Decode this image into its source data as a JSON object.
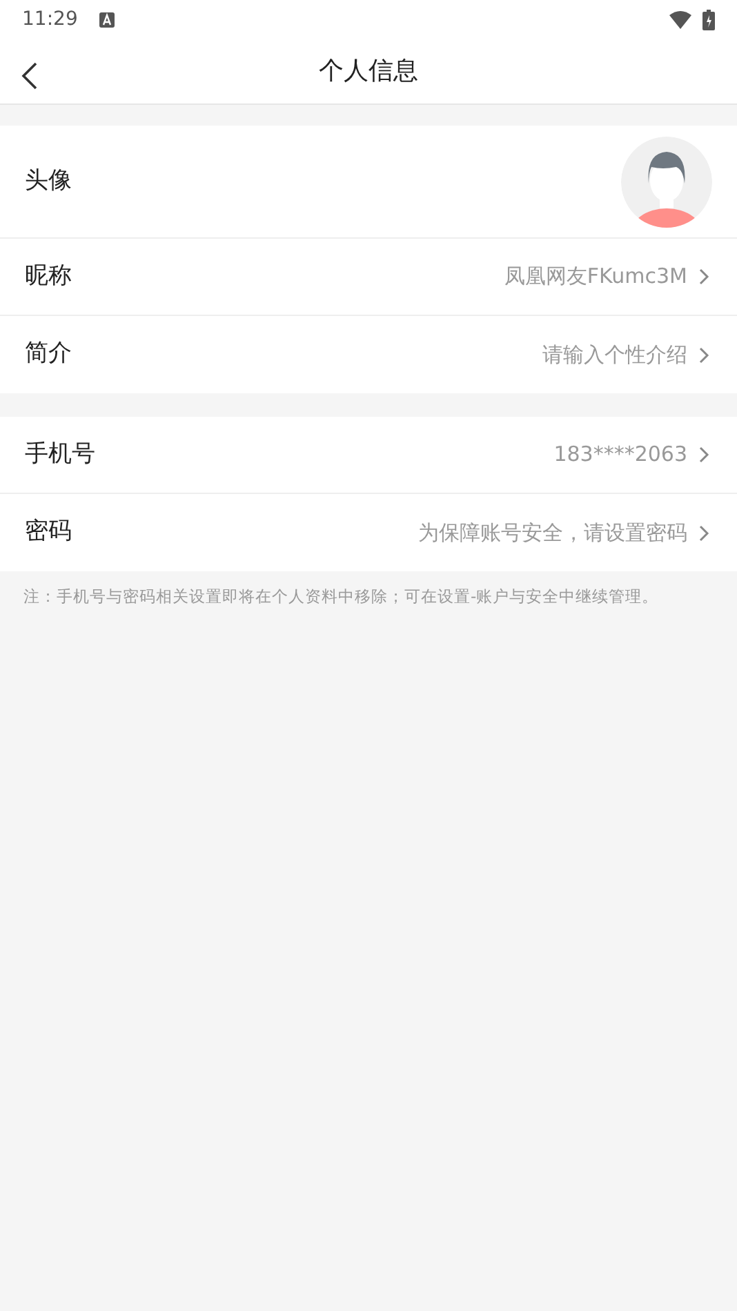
{
  "status_bar": {
    "time": "11:29"
  },
  "header": {
    "title": "个人信息"
  },
  "groups": [
    {
      "rows": [
        {
          "kind": "avatar",
          "label": "头像"
        },
        {
          "kind": "text",
          "label": "昵称",
          "value": "凤凰网友FKumc3M"
        },
        {
          "kind": "text",
          "label": "简介",
          "value": "请输入个性介绍"
        }
      ]
    },
    {
      "rows": [
        {
          "kind": "text",
          "label": "手机号",
          "value": "183****2063"
        },
        {
          "kind": "text",
          "label": "密码",
          "value": "为保障账号安全，请设置密码"
        }
      ]
    }
  ],
  "note": "注：手机号与密码相关设置即将在个人资料中移除；可在设置-账户与安全中继续管理。"
}
